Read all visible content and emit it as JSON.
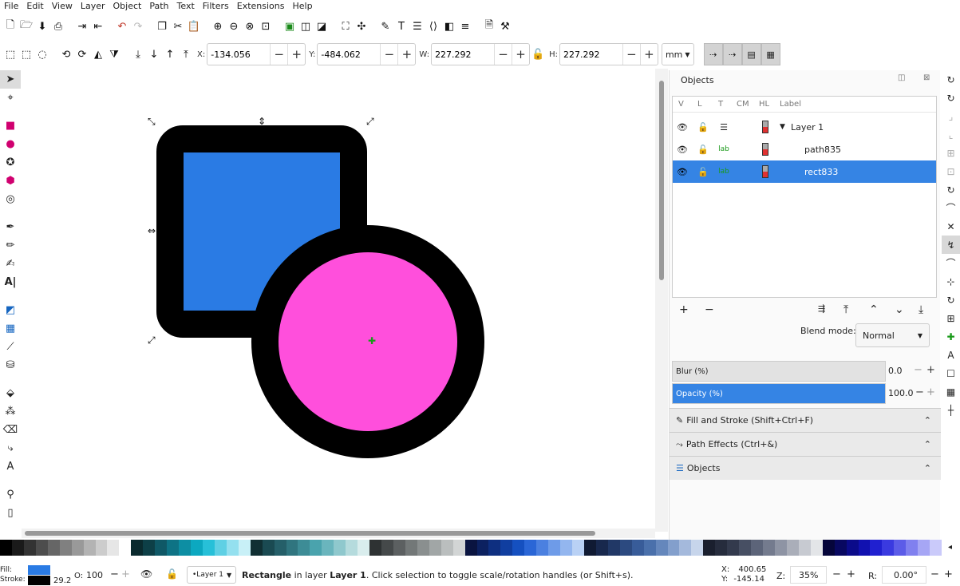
{
  "menu": [
    "File",
    "Edit",
    "View",
    "Layer",
    "Object",
    "Path",
    "Text",
    "Filters",
    "Extensions",
    "Help"
  ],
  "controls": {
    "x_label": "X:",
    "x_value": "-134.056",
    "y_label": "Y:",
    "y_value": "-484.062",
    "w_label": "W:",
    "w_value": "227.292",
    "h_label": "H:",
    "h_value": "227.292",
    "unit": "mm"
  },
  "objects_panel": {
    "title": "Objects",
    "columns": [
      "V",
      "L",
      "T",
      "CM",
      "HL",
      "Label"
    ],
    "rows": [
      {
        "label": "Layer 1",
        "selected": false,
        "indent": 0
      },
      {
        "label": "path835",
        "selected": false,
        "indent": 1
      },
      {
        "label": "rect833",
        "selected": true,
        "indent": 1
      }
    ],
    "blend_label": "Blend mode:",
    "blend_value": "Normal",
    "blur_label": "Blur (%)",
    "blur_value": "0.0",
    "opacity_label": "Opacity (%)",
    "opacity_value": "100.0",
    "docks": [
      "Fill and Stroke (Shift+Ctrl+F)",
      "Path Effects (Ctrl+&)",
      "Objects"
    ]
  },
  "canvas": {
    "rect_fill": "#2a7be4",
    "circle_fill": "#ff4fdc",
    "stroke": "#000000"
  },
  "status": {
    "fill_label": "Fill:",
    "stroke_label": "Stroke:",
    "stroke_width": "29.2",
    "opacity_label": "O:",
    "opacity_value": "100",
    "layer": "•Layer 1",
    "message_bold": "Rectangle",
    "message_rest": " in layer ",
    "message_layer": "Layer 1",
    "message_tail": ". Click selection to toggle scale/rotation handles (or Shift+s).",
    "x": "400.65",
    "y": "-145.14",
    "z_label": "Z:",
    "zoom": "35%",
    "r_label": "R:",
    "rotation": "0.00°"
  },
  "palette": [
    "#000000",
    "#1a1a1a",
    "#333333",
    "#4d4d4d",
    "#666666",
    "#808080",
    "#999999",
    "#b3b3b3",
    "#cccccc",
    "#e6e6e6",
    "#ffffff",
    "#0a2a2e",
    "#0d3f47",
    "#0f5866",
    "#0e7385",
    "#0d8ea3",
    "#0ca8c0",
    "#27c0d8",
    "#5fd0e4",
    "#94e0ef",
    "#c8f0f7",
    "#102f33",
    "#1a4a52",
    "#255f69",
    "#30757f",
    "#3d8c96",
    "#4aa3ad",
    "#6ab5bd",
    "#8fc8cd",
    "#b5dbdd",
    "#d9eded",
    "#2e3233",
    "#45494a",
    "#5c6061",
    "#737878",
    "#8a8f8f",
    "#a1a6a6",
    "#babebe",
    "#d2d5d5",
    "#0a1440",
    "#0c2160",
    "#0e2f80",
    "#103ea0",
    "#1550c0",
    "#2a66d6",
    "#4b80e0",
    "#6e9be8",
    "#93b6ef",
    "#b9d1f5",
    "#101a33",
    "#18284d",
    "#213866",
    "#2c4a80",
    "#385c99",
    "#4a70ab",
    "#6587bc",
    "#839fcc",
    "#a4b9dc",
    "#c7d5eb",
    "#1a1f2e",
    "#262c3d",
    "#333a4d",
    "#474f63",
    "#5c6479",
    "#747b8e",
    "#8e94a4",
    "#aaaeb9",
    "#c7cad1",
    "#e3e5e8",
    "#05053a",
    "#080860",
    "#0b0b8a",
    "#1111b0",
    "#2020d0",
    "#3a3ae0",
    "#5c5ce8",
    "#8080ef",
    "#a6a6f5",
    "#cacafa"
  ]
}
